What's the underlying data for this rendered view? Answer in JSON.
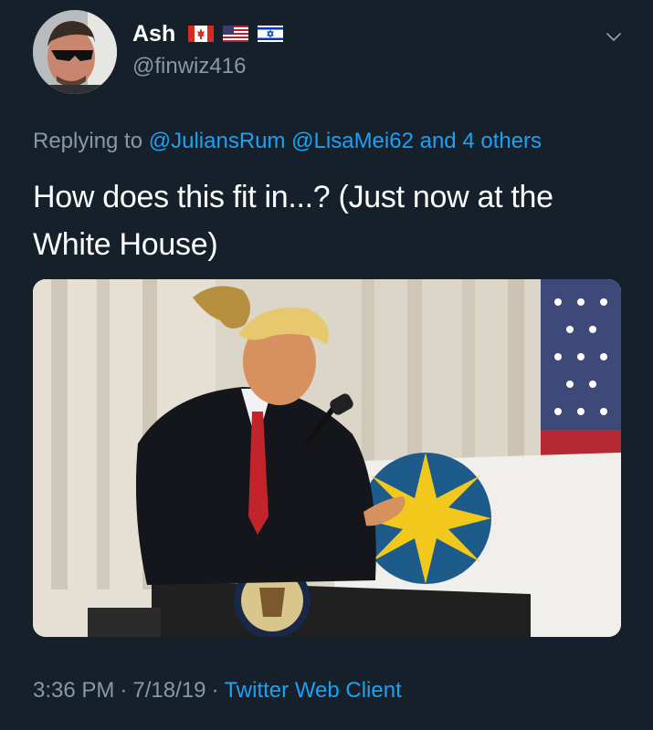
{
  "author": {
    "display_name": "Ash",
    "handle": "@finwiz416",
    "flags": [
      "canada-flag-icon",
      "usa-flag-icon",
      "israel-flag-icon"
    ]
  },
  "reply": {
    "prefix": "Replying to ",
    "mentions": [
      "@JuliansRum",
      "@LisaMei62"
    ],
    "connector": " and ",
    "others": "4 others"
  },
  "tweet": {
    "text": "How does this fit in...? (Just now at the White House)"
  },
  "meta": {
    "time": "3:36 PM",
    "separator": "·",
    "date": "7/18/19",
    "client": "Twitter Web Client"
  },
  "colors": {
    "background": "#15202b",
    "secondary_text": "#8899a6",
    "link": "#1da1f2",
    "primary_text": "#ffffff"
  }
}
